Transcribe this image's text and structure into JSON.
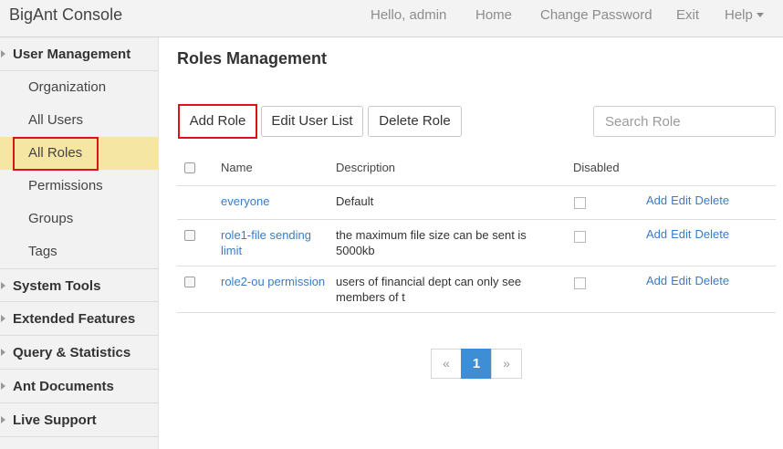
{
  "navbar": {
    "brand": "BigAnt Console",
    "greeting": "Hello, admin",
    "home": "Home",
    "change_password": "Change Password",
    "exit": "Exit",
    "help": "Help"
  },
  "sidebar": {
    "user_management": "User Management",
    "items": [
      "Organization",
      "All Users",
      "All Roles",
      "Permissions",
      "Groups",
      "Tags"
    ],
    "system_tools": "System Tools",
    "extended_features": "Extended Features",
    "query_statistics": "Query & Statistics",
    "ant_documents": "Ant Documents",
    "live_support": "Live Support"
  },
  "main": {
    "title": "Roles Management",
    "add_role": "Add Role",
    "edit_user_list": "Edit User List",
    "delete_role": "Delete Role",
    "search_placeholder": "Search Role"
  },
  "table": {
    "headers": {
      "name": "Name",
      "description": "Description",
      "disabled": "Disabled"
    },
    "rows": [
      {
        "name": "everyone",
        "description": "Default",
        "add": "Add",
        "edit": "Edit",
        "delete": "Delete"
      },
      {
        "name": "role1-file sending limit",
        "description": "the maximum file size can be sent is 5000kb",
        "add": "Add",
        "edit": "Edit",
        "delete": "Delete"
      },
      {
        "name": "role2-ou permission",
        "description": "users of financial dept can only see members of t",
        "add": "Add",
        "edit": "Edit",
        "delete": "Delete"
      }
    ]
  },
  "pagination": {
    "prev": "«",
    "current": "1",
    "next": "»"
  },
  "colors": {
    "accent": "#3d8ed4",
    "link": "#3a7bc8",
    "active_item": "#f5e6a3",
    "highlight": "#d9151b"
  }
}
